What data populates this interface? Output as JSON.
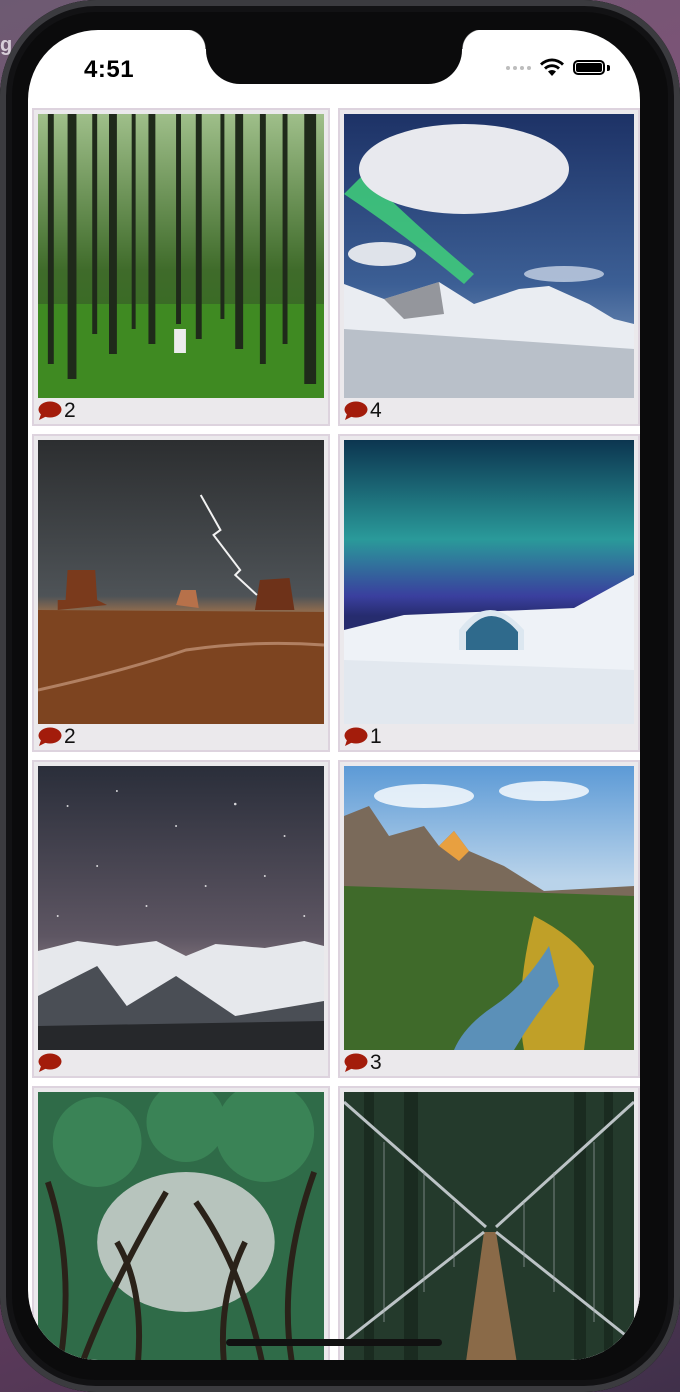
{
  "status_bar": {
    "time": "4:51"
  },
  "photos": [
    {
      "scene": "forest",
      "comment_count": "2"
    },
    {
      "scene": "aurora-mountain",
      "comment_count": "4"
    },
    {
      "scene": "desert-storm",
      "comment_count": "2"
    },
    {
      "scene": "ice-hotel-aurora",
      "comment_count": "1"
    },
    {
      "scene": "starry-snow-peaks",
      "comment_count": ""
    },
    {
      "scene": "canyon-river",
      "comment_count": "3"
    },
    {
      "scene": "tree-canopy",
      "comment_count": ""
    },
    {
      "scene": "suspension-bridge",
      "comment_count": ""
    }
  ],
  "colors": {
    "comment_icon": "#a31c0b",
    "cell_bg": "#ebe9ec"
  },
  "icons": {
    "comment": "speech-bubble-icon",
    "wifi": "wifi-icon",
    "battery": "battery-icon"
  }
}
